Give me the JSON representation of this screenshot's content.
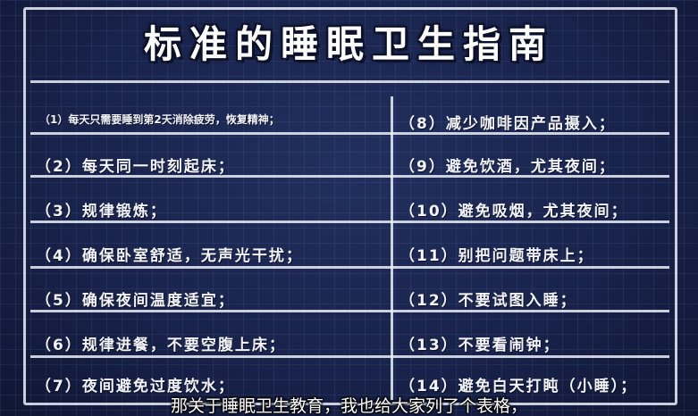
{
  "title": "标准的睡眠卫生指南",
  "left_items": [
    "（1）每天只需要睡到第2天消除疲劳，恢复精神；",
    "（2）每天同一时刻起床；",
    "（3）规律锻炼；",
    "（4）确保卧室舒适，无声光干扰；",
    "（5）确保夜间温度适宜；",
    "（6）规律进餐，不要空腹上床；",
    "（7）夜间避免过度饮水；"
  ],
  "right_items": [
    "（8）减少咖啡因产品摄入；",
    "（9）避免饮酒，尤其夜间；",
    "（10）避免吸烟，尤其夜间；",
    "（11）别把问题带床上；",
    "（12）不要试图入睡；",
    "（13）不要看闹钟；",
    "（14）避免白天打盹（小睡）；"
  ],
  "subtitle": "那关于睡眠卫生教育，我也给大家列了个表格，"
}
